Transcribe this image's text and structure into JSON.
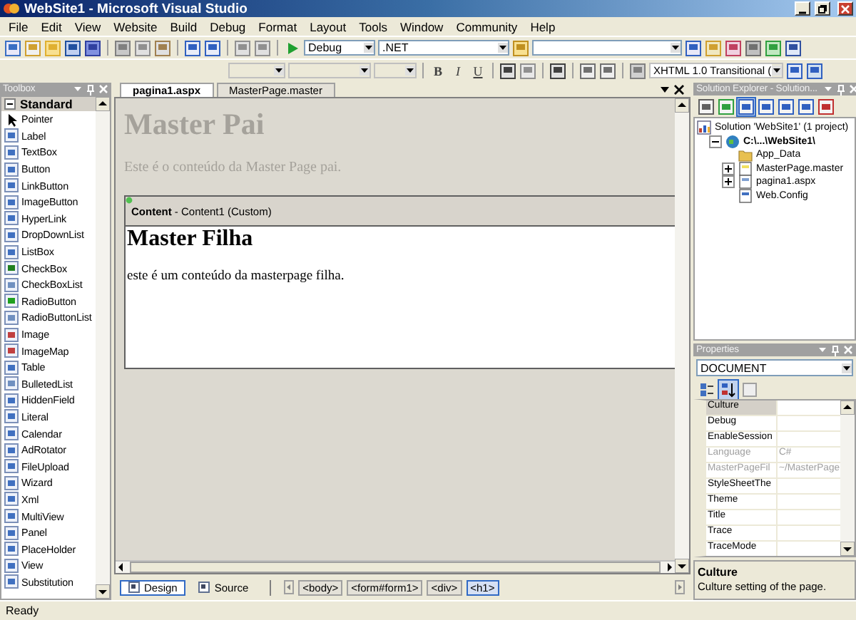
{
  "window": {
    "title": "WebSite1 - Microsoft Visual Studio"
  },
  "menu": [
    "File",
    "Edit",
    "View",
    "Website",
    "Build",
    "Debug",
    "Format",
    "Layout",
    "Tools",
    "Window",
    "Community",
    "Help"
  ],
  "toolbar": {
    "configuration": "Debug",
    "platform": ".NET"
  },
  "format_toolbar": {
    "buttons": [
      "B",
      "I",
      "U"
    ],
    "doctype": "XHTML 1.0 Transitional ("
  },
  "toolbox": {
    "title": "Toolbox",
    "group": "Standard",
    "group_expanded": true,
    "items": [
      {
        "label": "Pointer",
        "kind": "pointer"
      },
      {
        "label": "Label",
        "kind": "control"
      },
      {
        "label": "TextBox",
        "kind": "control"
      },
      {
        "label": "Button",
        "kind": "control"
      },
      {
        "label": "LinkButton",
        "kind": "control"
      },
      {
        "label": "ImageButton",
        "kind": "control"
      },
      {
        "label": "HyperLink",
        "kind": "control"
      },
      {
        "label": "DropDownList",
        "kind": "control"
      },
      {
        "label": "ListBox",
        "kind": "control"
      },
      {
        "label": "CheckBox",
        "kind": "check"
      },
      {
        "label": "CheckBoxList",
        "kind": "list"
      },
      {
        "label": "RadioButton",
        "kind": "radio"
      },
      {
        "label": "RadioButtonList",
        "kind": "list"
      },
      {
        "label": "Image",
        "kind": "image"
      },
      {
        "label": "ImageMap",
        "kind": "image"
      },
      {
        "label": "Table",
        "kind": "control"
      },
      {
        "label": "BulletedList",
        "kind": "list"
      },
      {
        "label": "HiddenField",
        "kind": "control"
      },
      {
        "label": "Literal",
        "kind": "control"
      },
      {
        "label": "Calendar",
        "kind": "control"
      },
      {
        "label": "AdRotator",
        "kind": "control"
      },
      {
        "label": "FileUpload",
        "kind": "control"
      },
      {
        "label": "Wizard",
        "kind": "control"
      },
      {
        "label": "Xml",
        "kind": "control"
      },
      {
        "label": "MultiView",
        "kind": "control"
      },
      {
        "label": "Panel",
        "kind": "control"
      },
      {
        "label": "PlaceHolder",
        "kind": "control"
      },
      {
        "label": "View",
        "kind": "control"
      },
      {
        "label": "Substitution",
        "kind": "control"
      }
    ]
  },
  "editor": {
    "tabs": [
      {
        "label": "pagina1.aspx",
        "selected": true
      },
      {
        "label": "MasterPage.master",
        "selected": false
      }
    ],
    "master_heading": "Master Pai",
    "master_text": "Este é o conteúdo da Master Page pai.",
    "content_region": {
      "label": "Content",
      "detail": "- Content1 (Custom)",
      "heading": "Master Filha",
      "text": "este é um conteúdo da masterpage filha."
    },
    "views": [
      {
        "label": "Design",
        "selected": true
      },
      {
        "label": "Source",
        "selected": false
      }
    ],
    "tag_path": [
      {
        "label": "<body>",
        "selected": false
      },
      {
        "label": "<form#form1>",
        "selected": false
      },
      {
        "label": "<div>",
        "selected": false
      },
      {
        "label": "<h1>",
        "selected": true
      }
    ]
  },
  "solution_explorer": {
    "title": "Solution Explorer - Solution...",
    "tree": [
      {
        "label": "Solution 'WebSite1' (1 project)",
        "kind": "solution",
        "children": [
          {
            "label": "C:\\...\\WebSite1\\",
            "kind": "website",
            "expanded": true,
            "children": [
              {
                "label": "App_Data",
                "kind": "folder"
              },
              {
                "label": "MasterPage.master",
                "kind": "master",
                "expanded": false
              },
              {
                "label": "pagina1.aspx",
                "kind": "page",
                "expanded": false
              },
              {
                "label": "Web.Config",
                "kind": "config"
              }
            ]
          }
        ]
      }
    ]
  },
  "properties": {
    "title": "Properties",
    "object": "DOCUMENT",
    "views": [
      {
        "kind": "categorized",
        "selected": false
      },
      {
        "kind": "alphabetical",
        "selected": true
      },
      {
        "kind": "pages",
        "selected": false
      }
    ],
    "rows": [
      {
        "name": "Culture",
        "selected": true,
        "disabled": false
      },
      {
        "name": "Debug",
        "selected": false,
        "disabled": false
      },
      {
        "name": "EnableSession",
        "selected": false,
        "disabled": false
      },
      {
        "name": "Language",
        "value": "C#",
        "selected": false,
        "disabled": true
      },
      {
        "name": "MasterPageFil",
        "value": "~/MasterPage",
        "selected": false,
        "disabled": true
      },
      {
        "name": "StyleSheetThe",
        "selected": false,
        "disabled": false
      },
      {
        "name": "Theme",
        "selected": false,
        "disabled": false
      },
      {
        "name": "Title",
        "selected": false,
        "disabled": false
      },
      {
        "name": "Trace",
        "selected": false,
        "disabled": false
      },
      {
        "name": "TraceMode",
        "selected": false,
        "disabled": false
      }
    ],
    "description_title": "Culture",
    "description_text": "Culture setting of the page."
  },
  "status_bar": "Ready"
}
